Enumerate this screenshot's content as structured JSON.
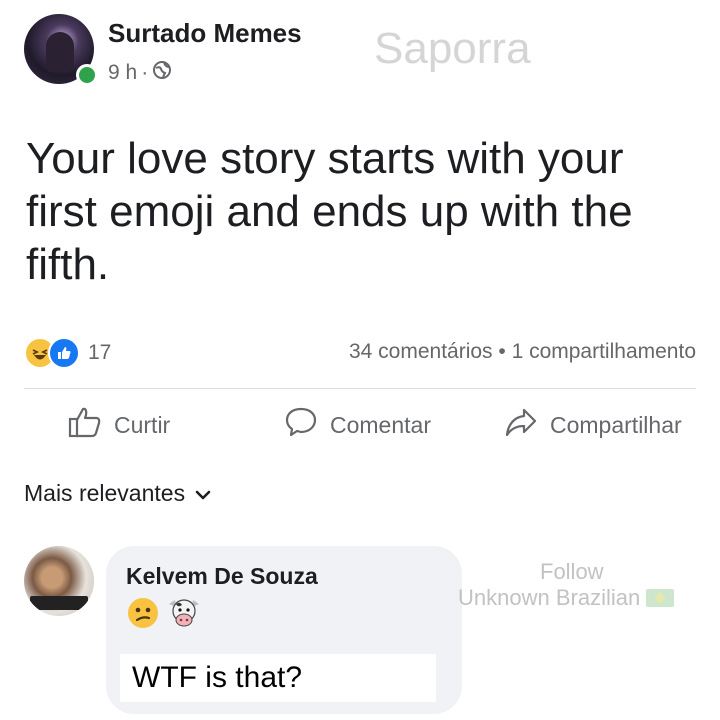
{
  "post": {
    "page_name": "Surtado Memes",
    "time": "9 h",
    "separator": "·",
    "privacy_icon": "globe-icon",
    "watermark": "Saporra",
    "text": "Your love story starts with your first emoji and ends up with the fifth.",
    "reactions": {
      "icons": [
        "haha-icon",
        "like-icon"
      ],
      "count": "17"
    },
    "counts": "34 comentários • 1 compartilhamento"
  },
  "actions": {
    "like": "Curtir",
    "comment": "Comentar",
    "share": "Compartilhar"
  },
  "comments_sort": {
    "label": "Mais relevantes",
    "icon": "chevron-down-icon"
  },
  "comment": {
    "author": "Kelvem De Souza",
    "emojis": [
      "confused-face-emoji",
      "cow-face-emoji"
    ],
    "reply_text": "WTF is that?"
  },
  "credit": {
    "follow": "Follow",
    "name": "Unknown Brazilian"
  },
  "colors": {
    "online": "#31a24c",
    "like_blue": "#1877f2",
    "haha_yellow": "#f7c340",
    "muted": "#65676b",
    "bubble": "#f0f2f5"
  }
}
